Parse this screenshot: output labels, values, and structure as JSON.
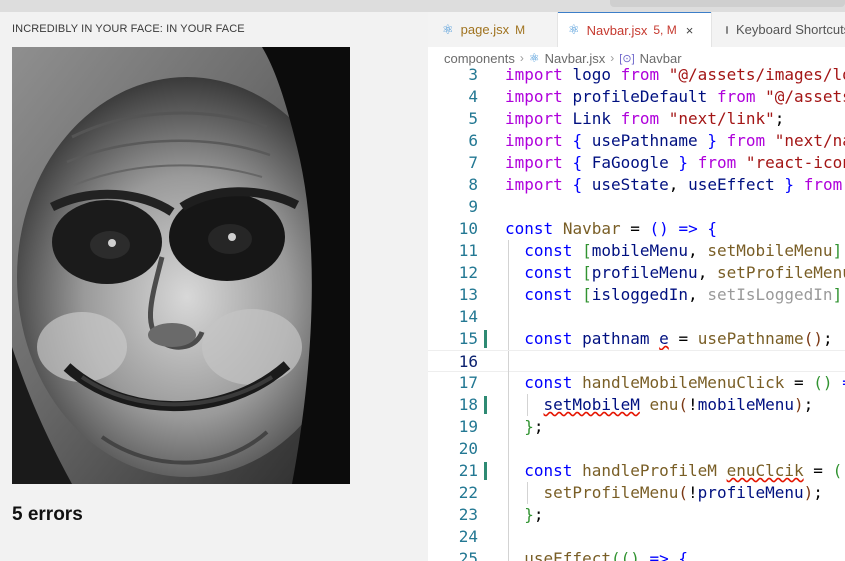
{
  "meme": {
    "caption": "INCREDIBLY IN YOUR FACE: IN YOUR FACE",
    "image_alt": "grayscale close-up of a grinning cartoon face",
    "errors_label": "5 errors"
  },
  "editor": {
    "tabs": [
      {
        "icon": "react-icon",
        "name": "page.jsx",
        "status": "M"
      },
      {
        "icon": "react-icon",
        "name": "Navbar.jsx",
        "status": "5, M",
        "close": "×"
      },
      {
        "icon": "keyboard-icon",
        "name": "Keyboard Shortcuts"
      }
    ],
    "breadcrumb": [
      "components",
      "Navbar.jsx",
      "Navbar"
    ],
    "code_lines": [
      {
        "n": "3",
        "text": "import logo from \"@/assets/images/lo"
      },
      {
        "n": "4",
        "text": "import profileDefault from \"@/assets"
      },
      {
        "n": "5",
        "text": "import Link from \"next/link\";"
      },
      {
        "n": "6",
        "text": "import { usePathname } from \"next/na"
      },
      {
        "n": "7",
        "text": "import { FaGoogle } from \"react-icon"
      },
      {
        "n": "8",
        "text": "import { useState, useEffect } from"
      },
      {
        "n": "9",
        "text": ""
      },
      {
        "n": "10",
        "text": "const Navbar = () => {"
      },
      {
        "n": "11",
        "text": "const [mobileMenu, setMobileMenu]"
      },
      {
        "n": "12",
        "text": "const [profileMenu, setProfileMenu"
      },
      {
        "n": "13",
        "text": "const [isloggedIn, setIsLoggedIn]"
      },
      {
        "n": "14",
        "text": ""
      },
      {
        "n": "15",
        "text": "const pathnam e = usePathname();"
      },
      {
        "n": "16",
        "text": ""
      },
      {
        "n": "17",
        "text": "const handleMobileMenuClick = () ="
      },
      {
        "n": "18",
        "text": "setMobileM enu(!mobileMenu);"
      },
      {
        "n": "19",
        "text": "};"
      },
      {
        "n": "20",
        "text": ""
      },
      {
        "n": "21",
        "text": "const handleProfileM enuClcik = ()"
      },
      {
        "n": "22",
        "text": "setProfileMenu(!profileMenu);"
      },
      {
        "n": "23",
        "text": "};"
      },
      {
        "n": "24",
        "text": ""
      },
      {
        "n": "25",
        "text": "useEffect(() => {"
      }
    ]
  },
  "colors": {
    "keyword": "#af00db",
    "declaration": "#0000ff",
    "string": "#a31515",
    "variable": "#001080",
    "function": "#795e26",
    "component": "#267f99",
    "line_number": "#237893",
    "modified_gutter": "#2e8a73",
    "error_squiggle": "#e51400"
  }
}
